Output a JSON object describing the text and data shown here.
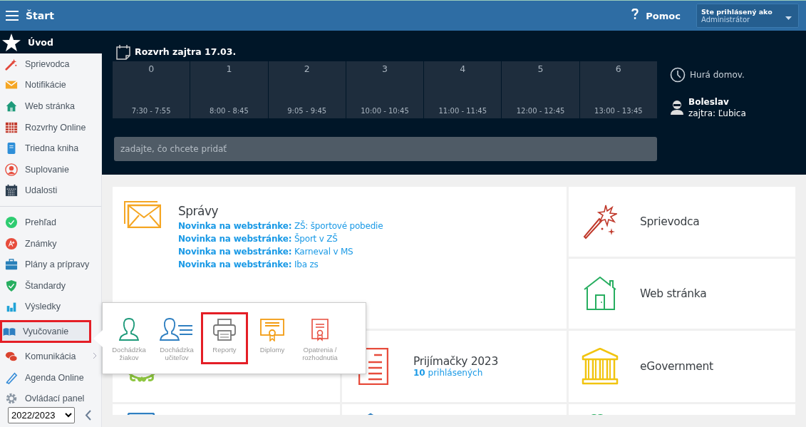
{
  "header": {
    "title": "Štart",
    "help": "Pomoc",
    "user_label": "Ste prihlásený ako",
    "user_role": "Administrátor"
  },
  "sidebar": {
    "home": "Úvod",
    "groups": [
      [
        {
          "label": "Sprievodca",
          "selected": false,
          "highlighted": false,
          "submenu": false
        },
        {
          "label": "Notifikácie",
          "selected": false,
          "highlighted": false,
          "submenu": false
        },
        {
          "label": "Web stránka",
          "selected": false,
          "highlighted": false,
          "submenu": false
        },
        {
          "label": "Rozvrhy Online",
          "selected": false,
          "highlighted": false,
          "submenu": false
        },
        {
          "label": "Triedna kniha",
          "selected": false,
          "highlighted": false,
          "submenu": false
        },
        {
          "label": "Suplovanie",
          "selected": false,
          "highlighted": false,
          "submenu": false
        },
        {
          "label": "Udalosti",
          "selected": false,
          "highlighted": false,
          "submenu": false
        }
      ],
      [
        {
          "label": "Prehľad",
          "selected": false,
          "highlighted": false,
          "submenu": false
        },
        {
          "label": "Známky",
          "selected": false,
          "highlighted": false,
          "submenu": false
        },
        {
          "label": "Plány a prípravy",
          "selected": false,
          "highlighted": false,
          "submenu": false
        },
        {
          "label": "Štandardy",
          "selected": false,
          "highlighted": false,
          "submenu": false
        },
        {
          "label": "Výsledky",
          "selected": false,
          "highlighted": false,
          "submenu": false
        },
        {
          "label": "Vyučovanie",
          "selected": true,
          "highlighted": true,
          "submenu": false
        },
        {
          "label": "Komunikácia",
          "selected": false,
          "highlighted": false,
          "submenu": true
        },
        {
          "label": "Agenda Online",
          "selected": false,
          "highlighted": false,
          "submenu": false
        },
        {
          "label": "Ovládací panel",
          "selected": false,
          "highlighted": false,
          "submenu": false
        }
      ]
    ],
    "year": "2022/2023"
  },
  "schedule": {
    "title": "Rozvrh zajtra 17.03.",
    "periods": [
      {
        "number": "0",
        "time": "7:30 - 7:55"
      },
      {
        "number": "1",
        "time": "8:00 - 8:45"
      },
      {
        "number": "2",
        "time": "9:05 - 9:45"
      },
      {
        "number": "3",
        "time": "10:00 - 10:45"
      },
      {
        "number": "4",
        "time": "11:00 - 11:45"
      },
      {
        "number": "5",
        "time": "12:00 - 12:45"
      },
      {
        "number": "6",
        "time": "13:00 - 13:45"
      }
    ],
    "placeholder": "zadajte, čo chcete pridať",
    "status": "Hurá domov.",
    "person": "Boleslav",
    "next": "zajtra: Ľubica"
  },
  "messages": {
    "title": "Správy",
    "items": [
      "**Novinka na webstránke:** ZŠ: športové pobedie",
      "**Novinka na webstránke:** Šport v ZŠ",
      "**Novinka na webstránke:** Karneval v MS",
      "**Novinka na webstránke:** Iba zs"
    ]
  },
  "tiles": [
    {
      "title": "Sprievodca"
    },
    {
      "title": "Web stránka"
    },
    {
      "title": "Prijímačky 2023",
      "subtitle": "**10** prihlásených"
    },
    {
      "title": "eGovernment"
    }
  ],
  "submenu": {
    "items": [
      {
        "label": "Dochádzka žiakov",
        "highlighted": false
      },
      {
        "label": "Dochádzka učiteľov",
        "highlighted": false
      },
      {
        "label": "Reporty",
        "highlighted": true
      },
      {
        "label": "Diplomy",
        "highlighted": false
      },
      {
        "label": "Opatrenia / rozhodnutia",
        "highlighted": false
      }
    ]
  }
}
